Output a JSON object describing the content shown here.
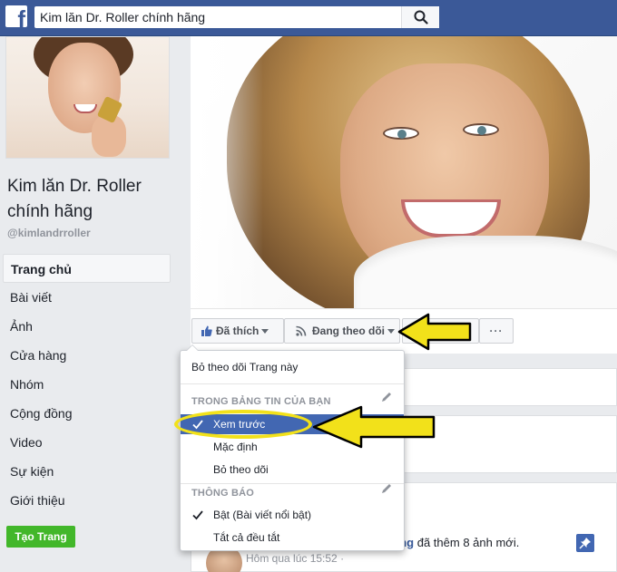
{
  "topbar": {
    "logo_letter": "f",
    "search_value": "Kim lăn Dr. Roller chính hãng",
    "brand_color": "#3b5998"
  },
  "page": {
    "name": "Kim lăn Dr. Roller chính hãng",
    "username": "@kimlandrroller"
  },
  "nav": {
    "items": [
      {
        "label": "Trang chủ"
      },
      {
        "label": "Bài viết"
      },
      {
        "label": "Ảnh"
      },
      {
        "label": "Cửa hàng"
      },
      {
        "label": "Nhóm"
      },
      {
        "label": "Cộng đồng"
      },
      {
        "label": "Video"
      },
      {
        "label": "Sự kiện"
      },
      {
        "label": "Giới thiệu"
      }
    ],
    "create_page": "Tạo Trang"
  },
  "actions": {
    "liked": "Đã thích",
    "following": "Đang theo dõi",
    "more": "···"
  },
  "dropdown": {
    "unfollow_page": "Bỏ theo dõi Trang này",
    "news_feed_header": "TRONG BẢNG TIN CỦA BẠN",
    "see_first": "Xem trước",
    "default": "Mặc định",
    "unfollow": "Bỏ theo dõi",
    "notifications_header": "THÔNG BÁO",
    "on_highlights": "Bật (Bài viết nổi bật)",
    "all_off": "Tắt cả đều tắt"
  },
  "post": {
    "author_fragment": "ăng",
    "action_text": " đã thêm 8 ảnh mới.",
    "timestamp": "Hôm qua lúc 15:52 ·"
  },
  "colors": {
    "accent": "#4267b2",
    "highlight": "#f2e11a",
    "create_button": "#42b72a"
  }
}
